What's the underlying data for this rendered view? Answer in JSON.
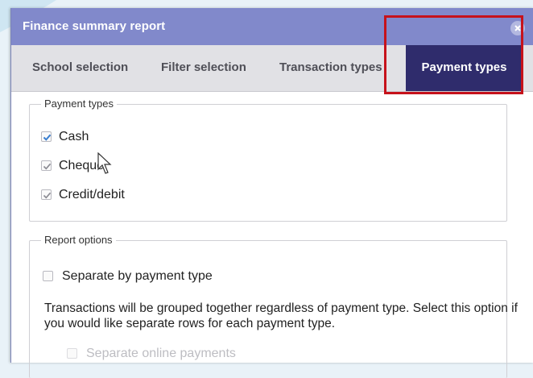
{
  "dialog": {
    "title": "Finance summary report",
    "close_icon": "close-icon"
  },
  "tabs": [
    {
      "label": "School selection",
      "active": false
    },
    {
      "label": "Filter selection",
      "active": false
    },
    {
      "label": "Transaction types",
      "active": false
    },
    {
      "label": "Payment types",
      "active": true
    }
  ],
  "payment_types": {
    "legend": "Payment types",
    "options": [
      {
        "label": "Cash",
        "checked": true
      },
      {
        "label": "Cheque",
        "checked": true
      },
      {
        "label": "Credit/debit",
        "checked": true
      }
    ]
  },
  "report_options": {
    "legend": "Report options",
    "separate_by_payment_type": {
      "label": "Separate by payment type",
      "checked": false
    },
    "description": "Transactions will be grouped together regardless of payment type. Select this option if you would like separate rows for each payment type.",
    "separate_online_payments": {
      "label": "Separate online payments",
      "checked": false,
      "disabled": true
    }
  },
  "colors": {
    "titlebar": "#8189cb",
    "active_tab": "#2f2c6c",
    "highlight": "#c6121b",
    "check": "#3b7fd0"
  }
}
